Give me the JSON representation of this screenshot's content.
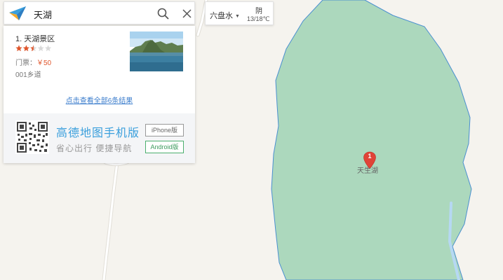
{
  "search": {
    "query": "天湖",
    "logo_icon": "amap-logo-icon",
    "search_icon": "search-icon",
    "clear_icon": "close-icon"
  },
  "city_weather": {
    "city": "六盘水",
    "condition": "阴",
    "temperature": "13/18℃"
  },
  "results": {
    "items": [
      {
        "title": "1. 天湖景区",
        "rating": 2.5,
        "rating_max": 5,
        "fee_label": "门票：",
        "fee_value": "￥50",
        "address": "001乡道"
      }
    ],
    "view_all": "点击查看全部6条结果"
  },
  "promo": {
    "title": "高德地图手机版",
    "slogan": "省心出行  便捷导航",
    "iphone": "iPhone版",
    "android": "Android版"
  },
  "map": {
    "poi_label": "天生湖",
    "marker_number": "1",
    "colors": {
      "background": "#f5f3ee",
      "water": "#acd8bd",
      "water_border": "#4a8fd0",
      "road": "#ffffff",
      "river": "#b6d8f3",
      "marker": "#e04438",
      "accent": "#3a9fdc"
    }
  }
}
